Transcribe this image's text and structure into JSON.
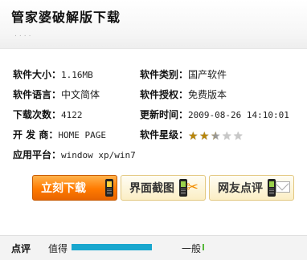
{
  "header": {
    "title": "管家婆破解版下载",
    "dots": "...."
  },
  "info": {
    "size_label": "软件大小：",
    "size_value": "1.16MB",
    "category_label": "软件类别：",
    "category_value": "国产软件",
    "language_label": "软件语言：",
    "language_value": "中文简体",
    "license_label": "软件授权：",
    "license_value": "免费版本",
    "downloads_label": "下载次数：",
    "downloads_value": "4122",
    "updated_label": "更新时间：",
    "updated_value": "2009-08-26 14:10:01",
    "developer_label": "开 发 商：",
    "developer_value": "HOME PAGE",
    "rating_label": "软件星级：",
    "rating_stars": 2.5,
    "rating_max": 5,
    "platform_label": "应用平台：",
    "platform_value": "window xp/win7"
  },
  "buttons": {
    "download": "立刻下载",
    "screenshots": "界面截图",
    "reviews": "网友点评"
  },
  "review_bar": {
    "label": "点评",
    "good_label": "值得",
    "good_fraction": 1.0,
    "normal_label": "一般"
  },
  "colors": {
    "download_bg": "#ff7a00",
    "meter_fill": "#19a7ce",
    "star_on": "#b8860b"
  }
}
